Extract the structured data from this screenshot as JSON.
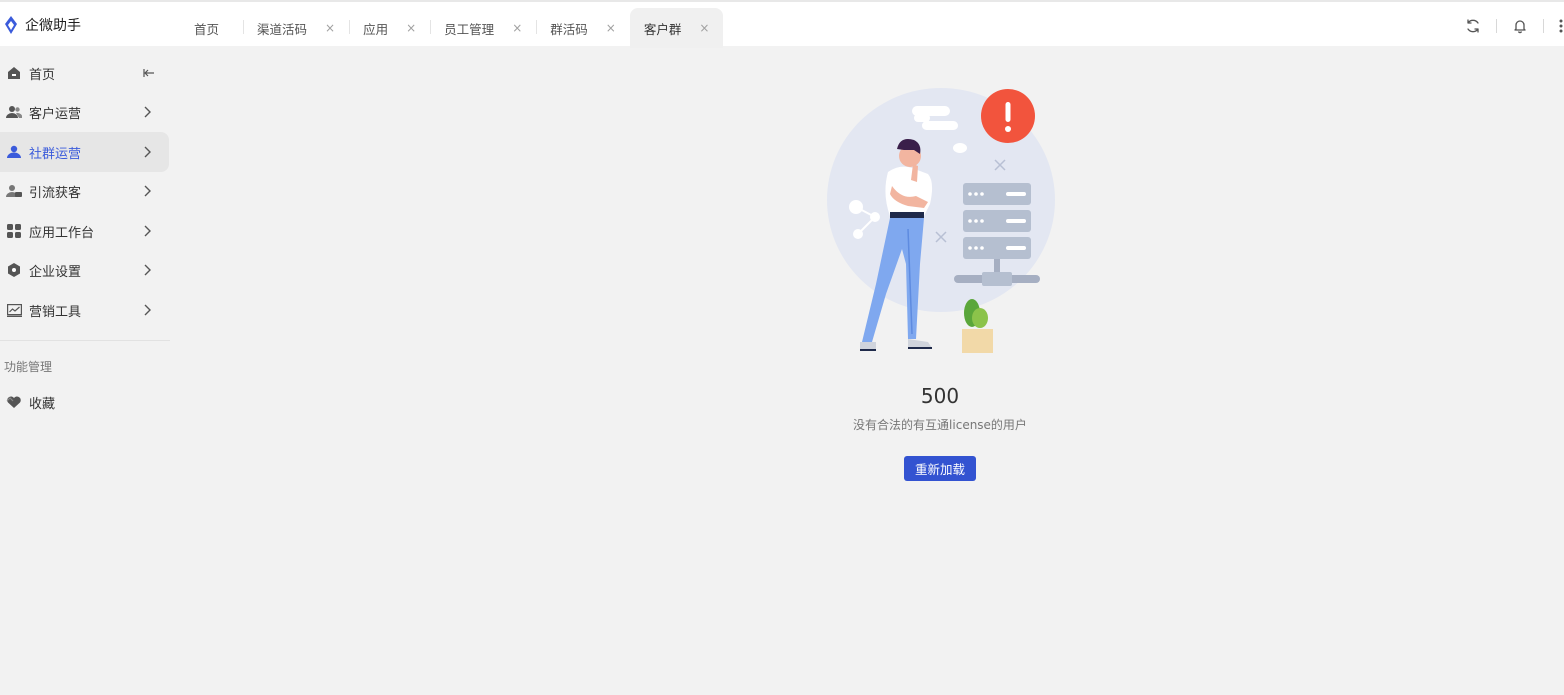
{
  "app": {
    "name": "企微助手"
  },
  "tabs": [
    {
      "label": "首页",
      "closable": false
    },
    {
      "label": "渠道活码",
      "closable": true
    },
    {
      "label": "应用",
      "closable": true
    },
    {
      "label": "员工管理",
      "closable": true
    },
    {
      "label": "群活码",
      "closable": true
    },
    {
      "label": "客户群",
      "closable": true,
      "active": true
    }
  ],
  "tab_close_glyph": "×",
  "top_actions": [
    "refresh-icon",
    "bell-icon",
    "more-icon"
  ],
  "sidebar": {
    "items": [
      {
        "label": "首页",
        "icon": "home-icon",
        "trailing": "collapse-icon"
      },
      {
        "label": "客户运营",
        "icon": "users-icon",
        "trailing": "chevron-right-icon"
      },
      {
        "label": "社群运营",
        "icon": "group-icon",
        "trailing": "chevron-right-icon",
        "active": true
      },
      {
        "label": "引流获客",
        "icon": "user-add-icon",
        "trailing": "chevron-right-icon"
      },
      {
        "label": "应用工作台",
        "icon": "apps-icon",
        "trailing": "chevron-right-icon"
      },
      {
        "label": "企业设置",
        "icon": "settings-icon",
        "trailing": "chevron-right-icon"
      },
      {
        "label": "营销工具",
        "icon": "chart-icon",
        "trailing": "chevron-right-icon"
      }
    ],
    "section_title": "功能管理",
    "favorites": {
      "label": "收藏",
      "icon": "heart-icon"
    }
  },
  "error": {
    "code": "500",
    "message": "没有合法的有互通license的用户",
    "reload_label": "重新加载"
  },
  "colors": {
    "accent": "#3353d1",
    "active_text": "#3b5bdb",
    "alert": "#f2543d",
    "background": "#f2f2f2"
  }
}
